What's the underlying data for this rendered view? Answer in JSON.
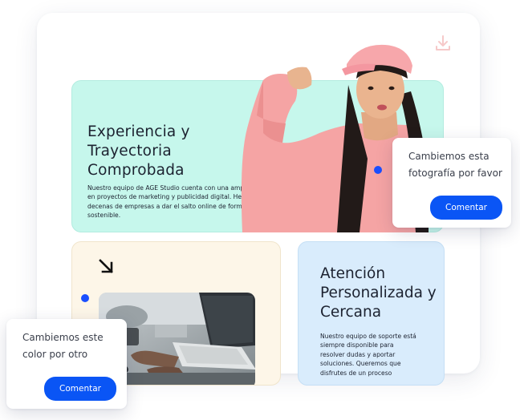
{
  "top_card": {
    "title": "Experiencia y Trayectoria Comprobada",
    "body": "Nuestro equipo de AGE Studio cuenta con una amplia trayectoria en proyectos de marketing y publicidad digital. Hemos ayudado a decenas de empresas a dar el salto online de forma rentable y sostenible."
  },
  "right_card": {
    "title": "Atención Personalizada y Cercana",
    "body": "Nuestro equipo de soporte está siempre disponible para resolver dudas y aportar soluciones. Queremos que disfrutes de un proceso"
  },
  "comment_photo": {
    "text": "Cambiemos esta fotografía por favor",
    "button": "Comentar"
  },
  "comment_color": {
    "text": "Cambiemos este color por otro",
    "button": "Comentar"
  },
  "colors": {
    "accent": "#0a55f5",
    "top_card_bg": "#c6f7ec",
    "left_card_bg": "#fdf6e8",
    "right_card_bg": "#d9ecfc"
  },
  "icons": [
    "download-icon",
    "arrow-down-right-icon"
  ]
}
